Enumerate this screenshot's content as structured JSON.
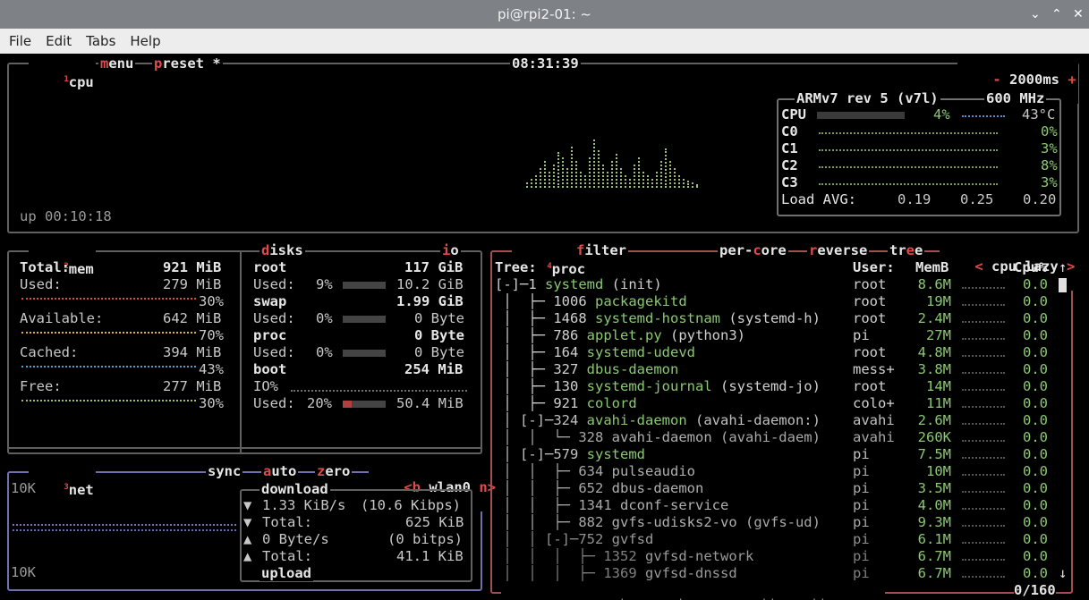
{
  "window": {
    "title": "pi@rpi2-01: ~",
    "controls": [
      "⌄",
      "⌃",
      "✕"
    ]
  },
  "menu": [
    "File",
    "Edit",
    "Tabs",
    "Help"
  ],
  "cpu_box": {
    "num": "1",
    "tabs": [
      "cpu",
      "menu",
      "preset *"
    ],
    "clock": "08:31:39",
    "interval": "2000ms",
    "minus": "-",
    "plus": "+",
    "uptime": "up 00:10:18",
    "model": "ARMv7 rev 5 (v7l)",
    "freq": "600 MHz",
    "cpu": {
      "label": "CPU",
      "pct": "4%",
      "temp": "43°C",
      "value": 4
    },
    "cores": [
      {
        "label": "C0",
        "pct": "0%"
      },
      {
        "label": "C1",
        "pct": "3%"
      },
      {
        "label": "C2",
        "pct": "8%"
      },
      {
        "label": "C3",
        "pct": "3%"
      }
    ],
    "load_label": "Load AVG:",
    "load": [
      "0.19",
      "0.25",
      "0.20"
    ]
  },
  "mem_box": {
    "num": "2",
    "title": "mem",
    "total": {
      "label": "Total:",
      "value": "921 MiB"
    },
    "rows": [
      {
        "label": "Used:",
        "value": "279 MiB",
        "pct": "30%",
        "color": "#d05050"
      },
      {
        "label": "Available:",
        "value": "642 MiB",
        "pct": "70%",
        "color": "#e0b040"
      },
      {
        "label": "Cached:",
        "value": "394 MiB",
        "pct": "43%",
        "color": "#50a0d0"
      },
      {
        "label": "Free:",
        "value": "277 MiB",
        "pct": "30%",
        "color": "#a0c060"
      }
    ]
  },
  "disks_box": {
    "title": "disks",
    "io": "io",
    "root": {
      "label": "root",
      "size": "117 GiB",
      "used_label": "Used:",
      "used_pct": "9%",
      "used": "10.2 GiB"
    },
    "swap": {
      "label": "swap",
      "size": "1.99 GiB",
      "used_label": "Used:",
      "used_pct": "0%",
      "used": "0 Byte"
    },
    "proc": {
      "label": "proc",
      "size": "0 Byte",
      "used_label": "Used:",
      "used_pct": "0%",
      "used": "0 Byte"
    },
    "boot": {
      "label": "boot",
      "size": "254 MiB",
      "io_label": "IO%",
      "used_label": "Used:",
      "used_pct": "20%",
      "used": "50.4 MiB"
    }
  },
  "net_box": {
    "num": "3",
    "title": "net",
    "sync": "sync",
    "auto": "auto",
    "zero": "zero",
    "b": "<b",
    "iface": "wlan0",
    "n": "n>",
    "scale_top": "10K",
    "scale_bottom": "10K",
    "download_label": "download",
    "dl_rate": "1.33 KiB/s",
    "dl_bits": "(10.6 Kibps)",
    "dl_total_label": "Total:",
    "dl_total": "625 KiB",
    "ul_rate": "0 Byte/s",
    "ul_bits": "(0 bitps)",
    "ul_total_label": "Total:",
    "ul_total": "41.1 KiB",
    "upload_label": "upload",
    "down_arrow": "▼",
    "up_arrow": "▲"
  },
  "proc_box": {
    "num": "4",
    "title": "proc",
    "filter": "filter",
    "per_core": "per-core",
    "reverse": "reverse",
    "tree": "tree",
    "sort_left": "<",
    "sort": "cpu lazy",
    "sort_right": ">",
    "headers": {
      "tree": "Tree:",
      "user": "User:",
      "mem": "MemB",
      "cpu": "Cpu%"
    },
    "rows": [
      {
        "prefix": "[-]─",
        "pid": "1",
        "name": "systemd",
        "args": " (init)",
        "user": "root",
        "mem": "8.6M",
        "cpu": "0.0",
        "indent": 0
      },
      {
        "prefix": " │  ├─ ",
        "pid": "1006",
        "name": "packagekitd",
        "args": "",
        "user": "root",
        "mem": "19M",
        "cpu": "0.0",
        "indent": 0
      },
      {
        "prefix": " │  ├─ ",
        "pid": "1468",
        "name": "systemd-hostnam",
        "args": " (systemd-h)",
        "user": "root",
        "mem": "2.4M",
        "cpu": "0.0",
        "indent": 0
      },
      {
        "prefix": " │  ├─ ",
        "pid": "786",
        "name": "applet.py",
        "args": " (python3)",
        "user": "pi",
        "mem": "27M",
        "cpu": "0.0",
        "indent": 0
      },
      {
        "prefix": " │  ├─ ",
        "pid": "164",
        "name": "systemd-udevd",
        "args": "",
        "user": "root",
        "mem": "4.8M",
        "cpu": "0.0",
        "indent": 0
      },
      {
        "prefix": " │  ├─ ",
        "pid": "327",
        "name": "dbus-daemon",
        "args": "",
        "user": "mess+",
        "mem": "3.8M",
        "cpu": "0.0",
        "indent": 0
      },
      {
        "prefix": " │  ├─ ",
        "pid": "130",
        "name": "systemd-journal",
        "args": " (systemd-jo)",
        "user": "root",
        "mem": "14M",
        "cpu": "0.0",
        "indent": 0
      },
      {
        "prefix": " │  ├─ ",
        "pid": "921",
        "name": "colord",
        "args": "",
        "user": "colo+",
        "mem": "11M",
        "cpu": "0.0",
        "indent": 0
      },
      {
        "prefix": " │ [-]─",
        "pid": "324",
        "name": "avahi-daemon",
        "args": " (avahi-daemon:)",
        "user": "avahi",
        "mem": "2.6M",
        "cpu": "0.0",
        "indent": 1
      },
      {
        "prefix": " │  │  └─ ",
        "pid": "328",
        "name": "avahi-daemon",
        "args": " (avahi-daem)",
        "user": "avahi",
        "mem": "260K",
        "cpu": "0.0",
        "indent": 2
      },
      {
        "prefix": " │ [-]─",
        "pid": "579",
        "name": "systemd",
        "args": "",
        "user": "pi",
        "mem": "7.5M",
        "cpu": "0.0",
        "indent": 1
      },
      {
        "prefix": " │  │  ├─ ",
        "pid": "634",
        "name": "pulseaudio",
        "args": "",
        "user": "pi",
        "mem": "10M",
        "cpu": "0.0",
        "indent": 2
      },
      {
        "prefix": " │  │  ├─ ",
        "pid": "652",
        "name": "dbus-daemon",
        "args": "",
        "user": "pi",
        "mem": "3.5M",
        "cpu": "0.0",
        "indent": 2
      },
      {
        "prefix": " │  │  ├─ ",
        "pid": "1341",
        "name": "dconf-service",
        "args": "",
        "user": "pi",
        "mem": "4.0M",
        "cpu": "0.0",
        "indent": 2
      },
      {
        "prefix": " │  │  ├─ ",
        "pid": "882",
        "name": "gvfs-udisks2-vo",
        "args": " (gvfs-ud)",
        "user": "pi",
        "mem": "9.3M",
        "cpu": "0.0",
        "indent": 2
      },
      {
        "prefix": " │  │ [-]─",
        "pid": "752",
        "name": "gvfsd",
        "args": "",
        "user": "pi",
        "mem": "6.1M",
        "cpu": "0.0",
        "indent": 3
      },
      {
        "prefix": " │  │  │  ├─ ",
        "pid": "1352",
        "name": "gvfsd-network",
        "args": "",
        "user": "pi",
        "mem": "6.7M",
        "cpu": "0.0",
        "indent": 4
      },
      {
        "prefix": " │  │  │  ├─ ",
        "pid": "1369",
        "name": "gvfsd-dnssd",
        "args": "",
        "user": "pi",
        "mem": "6.7M",
        "cpu": "0.0",
        "indent": 4
      }
    ],
    "footer": {
      "select": "select",
      "info": "info",
      "terminate": "terminate",
      "kill": "kill",
      "signals": "signals",
      "count": "0/160"
    },
    "scroll_up": "↑",
    "scroll_down": "↓"
  }
}
